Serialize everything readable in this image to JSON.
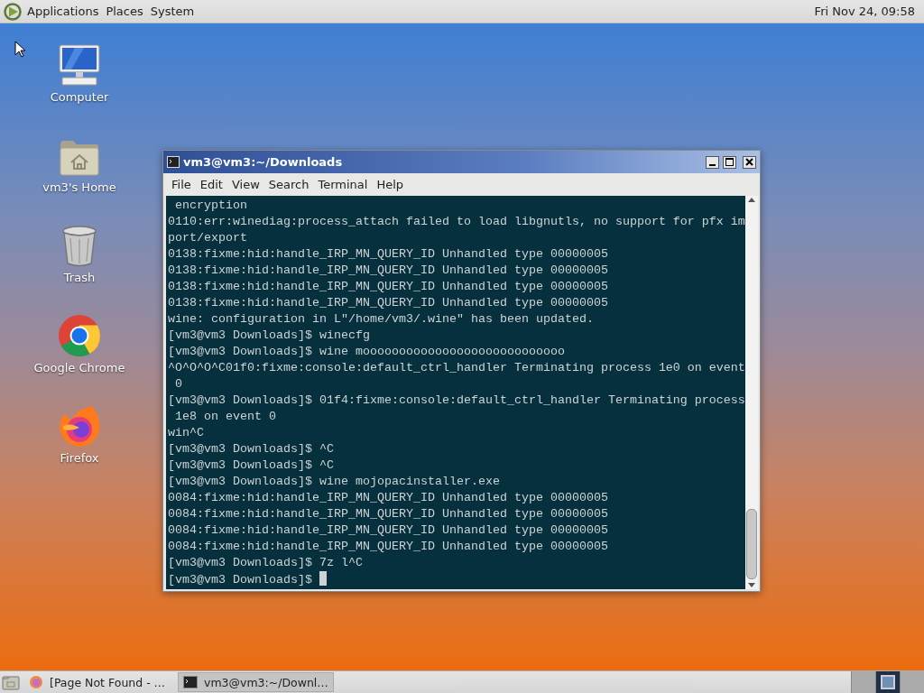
{
  "top_panel": {
    "menus": [
      "Applications",
      "Places",
      "System"
    ],
    "clock": "Fri Nov 24, 09:58"
  },
  "desktop_icons": [
    {
      "label": "Computer",
      "kind": "computer"
    },
    {
      "label": "vm3's Home",
      "kind": "home"
    },
    {
      "label": "Trash",
      "kind": "trash"
    },
    {
      "label": "Google Chrome",
      "kind": "chrome"
    },
    {
      "label": "Firefox",
      "kind": "firefox"
    }
  ],
  "terminal": {
    "title": "vm3@vm3:~/Downloads",
    "menu": [
      "File",
      "Edit",
      "View",
      "Search",
      "Terminal",
      "Help"
    ],
    "lines": [
      " encryption",
      "0110:err:winediag:process_attach failed to load libgnutls, no support for pfx im",
      "port/export",
      "0138:fixme:hid:handle_IRP_MN_QUERY_ID Unhandled type 00000005",
      "0138:fixme:hid:handle_IRP_MN_QUERY_ID Unhandled type 00000005",
      "0138:fixme:hid:handle_IRP_MN_QUERY_ID Unhandled type 00000005",
      "0138:fixme:hid:handle_IRP_MN_QUERY_ID Unhandled type 00000005",
      "wine: configuration in L\"/home/vm3/.wine\" has been updated.",
      "[vm3@vm3 Downloads]$ winecfg",
      "[vm3@vm3 Downloads]$ wine moooooooooooooooooooooooooooo",
      "^O^O^O^C01f0:fixme:console:default_ctrl_handler Terminating process 1e0 on event",
      " 0",
      "[vm3@vm3 Downloads]$ 01f4:fixme:console:default_ctrl_handler Terminating process",
      " 1e8 on event 0",
      "win^C",
      "[vm3@vm3 Downloads]$ ^C",
      "[vm3@vm3 Downloads]$ ^C",
      "[vm3@vm3 Downloads]$ wine mojopacinstaller.exe",
      "0084:fixme:hid:handle_IRP_MN_QUERY_ID Unhandled type 00000005",
      "0084:fixme:hid:handle_IRP_MN_QUERY_ID Unhandled type 00000005",
      "0084:fixme:hid:handle_IRP_MN_QUERY_ID Unhandled type 00000005",
      "0084:fixme:hid:handle_IRP_MN_QUERY_ID Unhandled type 00000005",
      "[vm3@vm3 Downloads]$ 7z l^C",
      "[vm3@vm3 Downloads]$ "
    ]
  },
  "taskbar": {
    "tasks": [
      {
        "label": "[Page Not Found - …",
        "kind": "browser",
        "selected": false
      },
      {
        "label": "vm3@vm3:~/Downl…",
        "kind": "terminal",
        "selected": true
      }
    ],
    "workspaces": [
      {
        "selected": false
      },
      {
        "selected": true
      },
      {
        "selected": false
      }
    ]
  }
}
